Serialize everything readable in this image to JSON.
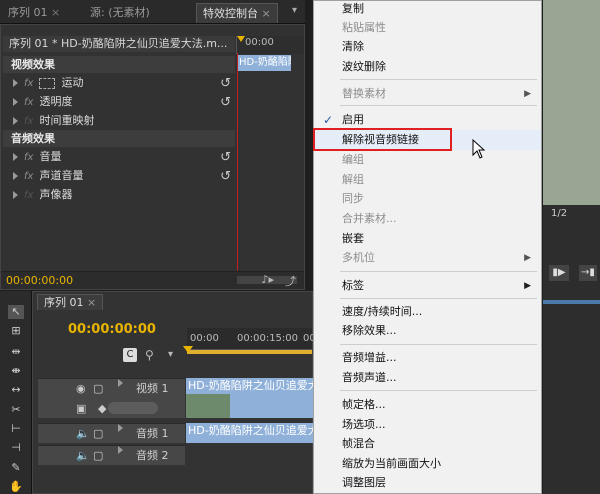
{
  "tabs": [
    {
      "label": "序列 01"
    },
    {
      "label": "源: (无素材)"
    },
    {
      "label": "特效控制台"
    }
  ],
  "effect_controls": {
    "sequence_title": "序列 01 * HD-奶酪陷阱之仙贝追爱大法.m...",
    "ruler_time": "00:00",
    "clip_label": "HD-奶酪陷阱",
    "video_section": "视频效果",
    "video_effects": [
      {
        "name": "运动",
        "reset": true
      },
      {
        "name": "透明度",
        "reset": true
      },
      {
        "name": "时间重映射",
        "reset": false
      }
    ],
    "audio_section": "音频效果",
    "audio_effects": [
      {
        "name": "音量",
        "reset": true
      },
      {
        "name": "声道音量",
        "reset": true
      },
      {
        "name": "声像器",
        "reset": false
      }
    ],
    "timecode": "00:00:00:00"
  },
  "context_menu": {
    "items": [
      {
        "label": "复制",
        "enabled": true
      },
      {
        "label": "粘贴属性",
        "enabled": false
      },
      {
        "label": "清除",
        "enabled": true
      },
      {
        "label": "波纹删除",
        "enabled": true
      },
      {
        "label": "替换素材",
        "enabled": false,
        "submenu": true
      },
      {
        "label": "启用",
        "enabled": true,
        "checked": true
      },
      {
        "label": "解除视音频链接",
        "enabled": true,
        "highlighted": true
      },
      {
        "label": "编组",
        "enabled": false
      },
      {
        "label": "解组",
        "enabled": false
      },
      {
        "label": "同步",
        "enabled": false
      },
      {
        "label": "合并素材...",
        "enabled": false
      },
      {
        "label": "嵌套",
        "enabled": true
      },
      {
        "label": "多机位",
        "enabled": false,
        "submenu": true
      },
      {
        "label": "标签",
        "enabled": true,
        "submenu": true
      },
      {
        "label": "速度/持续时间...",
        "enabled": true
      },
      {
        "label": "移除效果...",
        "enabled": true
      },
      {
        "label": "音频增益...",
        "enabled": true
      },
      {
        "label": "音频声道...",
        "enabled": true
      },
      {
        "label": "帧定格...",
        "enabled": true
      },
      {
        "label": "场选项...",
        "enabled": true
      },
      {
        "label": "帧混合",
        "enabled": true
      },
      {
        "label": "缩放为当前画面大小",
        "enabled": true
      },
      {
        "label": "调整图层",
        "enabled": true
      }
    ]
  },
  "timeline": {
    "tab": "序列 01",
    "timecode": "00:00:00:00",
    "ruler": [
      "00:00",
      "00:00:15:00",
      "00:00"
    ],
    "tracks": [
      {
        "name": "视频 1",
        "clip": "HD-奶酪陷阱之仙贝追爱大"
      },
      {
        "name": "音频 1",
        "clip": "HD-奶酪陷阱之仙贝追爱大"
      },
      {
        "name": "音频 2",
        "clip": ""
      }
    ]
  },
  "program_monitor": {
    "zoom": "1/2"
  },
  "colors": {
    "highlight_box": "#e02020",
    "timecode": "#e8b400",
    "clip_video": "#8fb0d8",
    "clip_audio": "#8fb0d8"
  }
}
